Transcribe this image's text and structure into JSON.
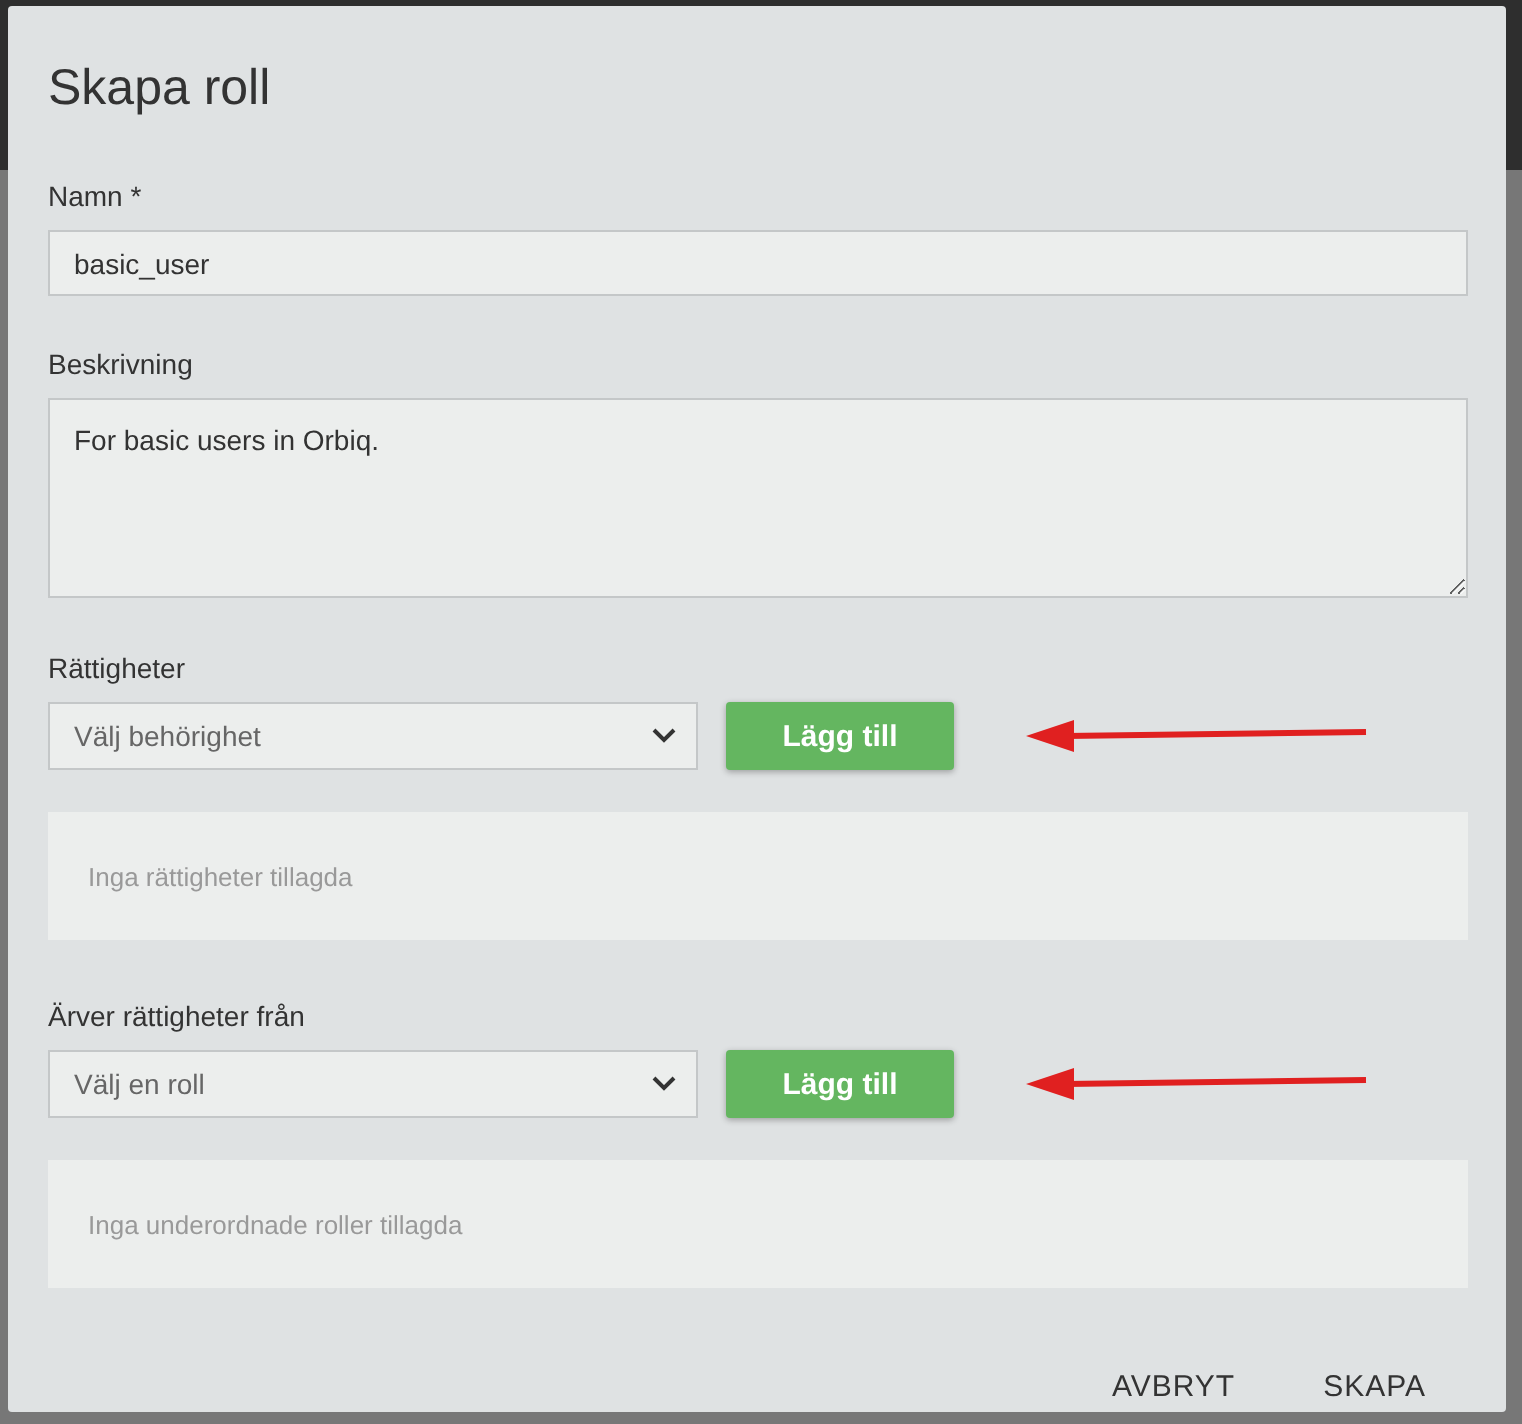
{
  "dialog": {
    "title": "Skapa roll"
  },
  "fields": [
    {
      "kind": "input",
      "label": "Namn *",
      "value": "basic_user"
    },
    {
      "kind": "textarea",
      "label": "Beskrivning",
      "value": "For basic users in Orbiq."
    },
    {
      "kind": "picker",
      "label": "Rättigheter",
      "placeholder": "Välj behörighet",
      "button": "Lägg till",
      "annotated": true,
      "empty_text": "Inga rättigheter tillagda"
    },
    {
      "kind": "picker",
      "label": "Ärver rättigheter från",
      "placeholder": "Välj en roll",
      "button": "Lägg till",
      "annotated": true,
      "empty_text": "Inga underordnade roller tillagda"
    }
  ],
  "actions": [
    "AVBRYT",
    "SKAPA"
  ]
}
